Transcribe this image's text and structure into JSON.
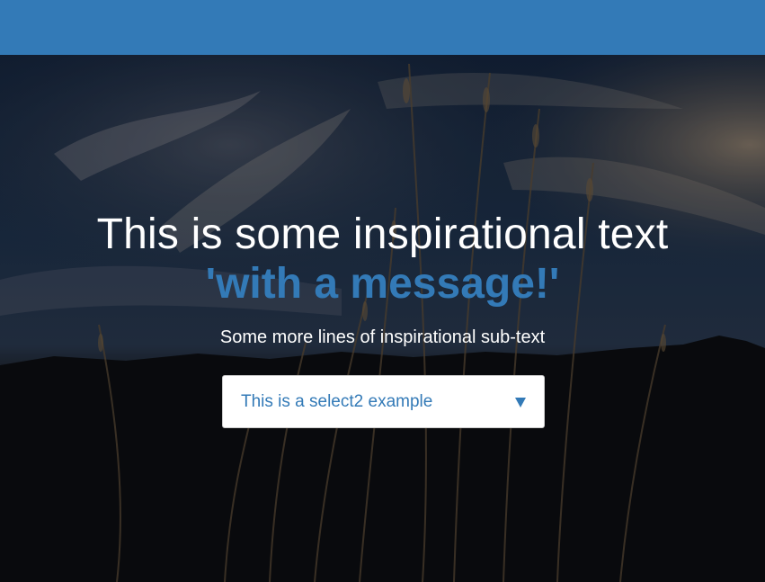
{
  "header": {
    "color": "#337ab7"
  },
  "hero": {
    "headline": "This is some inspirational text",
    "headline_accent": "'with a message!'",
    "subtext": "Some more lines of inspirational sub-text",
    "accent_color": "#337ab7"
  },
  "select": {
    "selected_value": "This is a select2 example",
    "icon": "caret-down-icon"
  }
}
